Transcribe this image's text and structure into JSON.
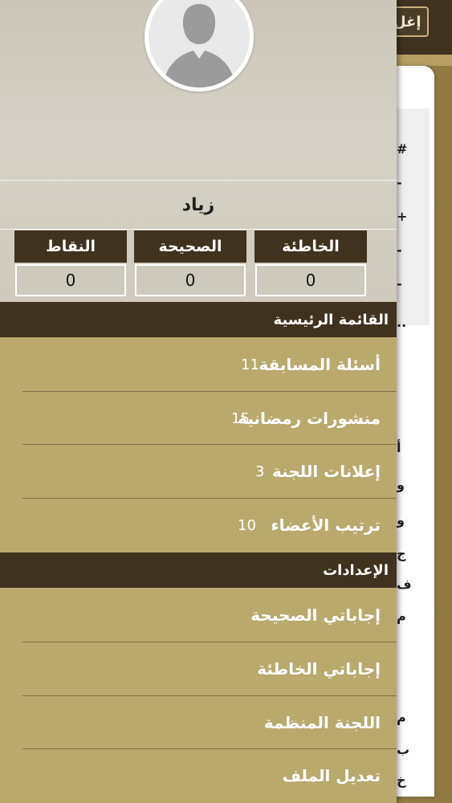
{
  "background": {
    "close_button": "إغل",
    "side_chars": [
      "#",
      "-",
      "+",
      "-",
      "-",
      "..",
      "أ",
      "و",
      "و",
      "ج",
      "ف",
      "م",
      "م",
      "ب",
      "خ"
    ]
  },
  "drawer": {
    "user_name": "زياد",
    "stats": [
      {
        "label": "النقاط",
        "value": "0"
      },
      {
        "label": "الصحيحة",
        "value": "0"
      },
      {
        "label": "الخاطئة",
        "value": "0"
      }
    ],
    "main_menu": {
      "title": "القائمة الرئيسية",
      "items": [
        {
          "label": "أسئلة المسابقة",
          "count": "11"
        },
        {
          "label": "منشورات رمضانية",
          "count": "15"
        },
        {
          "label": "إعلانات اللجنة",
          "count": "3"
        },
        {
          "label": "ترتيب الأعضاء",
          "count": "10"
        }
      ]
    },
    "settings": {
      "title": "الإعدادات",
      "items": [
        {
          "label": "إجاباتي الصحيحة"
        },
        {
          "label": "إجاباتي الخاطئة"
        },
        {
          "label": "اللجنة المنظمة"
        },
        {
          "label": "تعديل الملف"
        }
      ]
    }
  },
  "colors": {
    "header_dark": "#3f321e",
    "drawer_gold": "#b9a96c",
    "profile_gray": "#cfcabd"
  }
}
